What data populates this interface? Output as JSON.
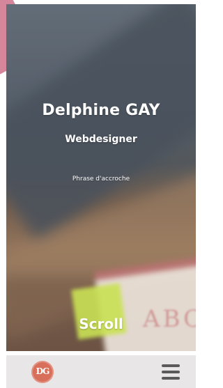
{
  "hero": {
    "name": "Delphine GAY",
    "role": "Webdesigner",
    "tagline": "Phrase d'accroche",
    "background_letters": "ABC"
  },
  "scroll": {
    "label": "Scroll"
  },
  "footer": {
    "logo_text": "DG",
    "menu_icon": "hamburger-menu-icon"
  },
  "colors": {
    "accent_pink": "#d47f95",
    "logo_orange": "#d86f5a",
    "footer_bg": "#e8e6e7",
    "text_white": "#ffffff"
  }
}
